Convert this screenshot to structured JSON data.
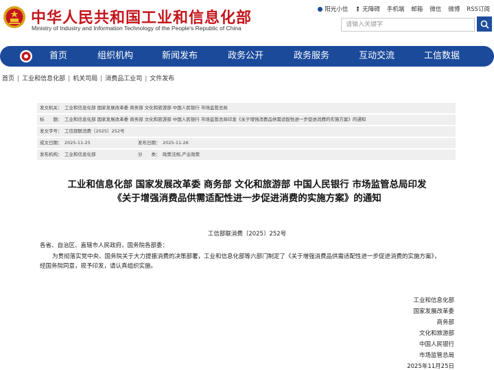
{
  "header": {
    "site_title": "中华人民共和国工业和信息化部",
    "site_subtitle": "Ministry of Industry and Information Technology of the People's Republic of China",
    "top_links": [
      "阳光小信",
      "无障碍",
      "手机端",
      "邮箱",
      "微信",
      "微博",
      "RSS订阅"
    ],
    "search_placeholder": "请输入关键字"
  },
  "nav": {
    "items": [
      "首页",
      "组织机构",
      "新闻发布",
      "政务公开",
      "政务服务",
      "互动交流",
      "工信数据"
    ]
  },
  "breadcrumb": [
    "首页",
    "工业和信息化部",
    "机关司局",
    "消费品工业司",
    "文件发布"
  ],
  "meta": {
    "issuer_label": "发文机关：",
    "issuer_value": "工业和信息化部 国家发展改革委 商务部 文化和旅游部 中国人民银行 市场监管总局",
    "title_label": "标　　题：",
    "title_value": "工业和信息化部 国家发展改革委 商务部 文化和旅游部 中国人民银行 市场监管总局印发《关于增强消费品供需适配性进一步促进消费的实施方案》的通知",
    "docno_label": "发文字号：",
    "docno_value": "工信部联消费〔2025〕252号",
    "date_label": "成文日期：",
    "date_value": "2025-11-25",
    "pubdate_label": "发布日期：",
    "pubdate_value": "2025-11-26",
    "org_label": "发布机构：",
    "org_value": "工业和信息化部",
    "cat_label": "分　　类：",
    "cat_value": "政策法规,产业政策"
  },
  "document": {
    "title_line1": "工业和信息化部 国家发展改革委 商务部 文化和旅游部 中国人民银行 市场监管总局印发",
    "title_line2": "《关于增强消费品供需适配性进一步促进消费的实施方案》的通知",
    "doc_number": "工信部联消费〔2025〕252号",
    "salutation": "各省、自治区、直辖市人民政府，国务院各部委：",
    "para1_line1": "为贯彻落实党中央、国务院关于大力提振消费的决策部署，工业和信息化部等六部门制定了《关于增强消费品供需适配性进一步促进消费的实施方案》，",
    "para1_line2": "经国务院同意，现予印发，请认真组织实施。",
    "signatories": [
      "工业和信息化部",
      "国家发展改革委",
      "商务部",
      "文化和旅游部",
      "中国人民银行",
      "市场监管总局",
      "2025年11月25日"
    ]
  },
  "colors": {
    "brand_red": "#c4151c",
    "nav_blue": "#1b4a9b"
  }
}
